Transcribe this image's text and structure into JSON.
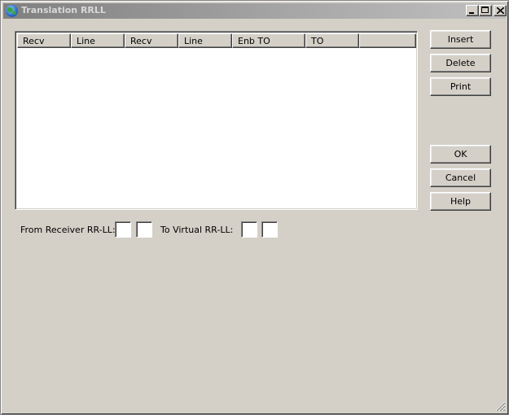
{
  "window": {
    "title": "Translation RRLL",
    "app_icon": "globe-icon",
    "caption_buttons": [
      "minimize-icon",
      "maximize-icon",
      "close-icon"
    ]
  },
  "list": {
    "columns": [
      "Recv",
      "Line",
      "Recv",
      "Line",
      "Enb TO",
      "TO",
      ""
    ],
    "rows": []
  },
  "buttons": {
    "insert": "Insert",
    "delete": "Delete",
    "print": "Print",
    "ok": "OK",
    "cancel": "Cancel",
    "help": "Help"
  },
  "fields": {
    "from_label": "From Receiver RR-LL:",
    "from_rr": "",
    "from_ll": "",
    "to_label": "To Virtual RR-LL:",
    "to_rr": "",
    "to_ll": ""
  },
  "colors": {
    "face": "#d4d0c8",
    "title_inactive": "#7f7f7f"
  }
}
